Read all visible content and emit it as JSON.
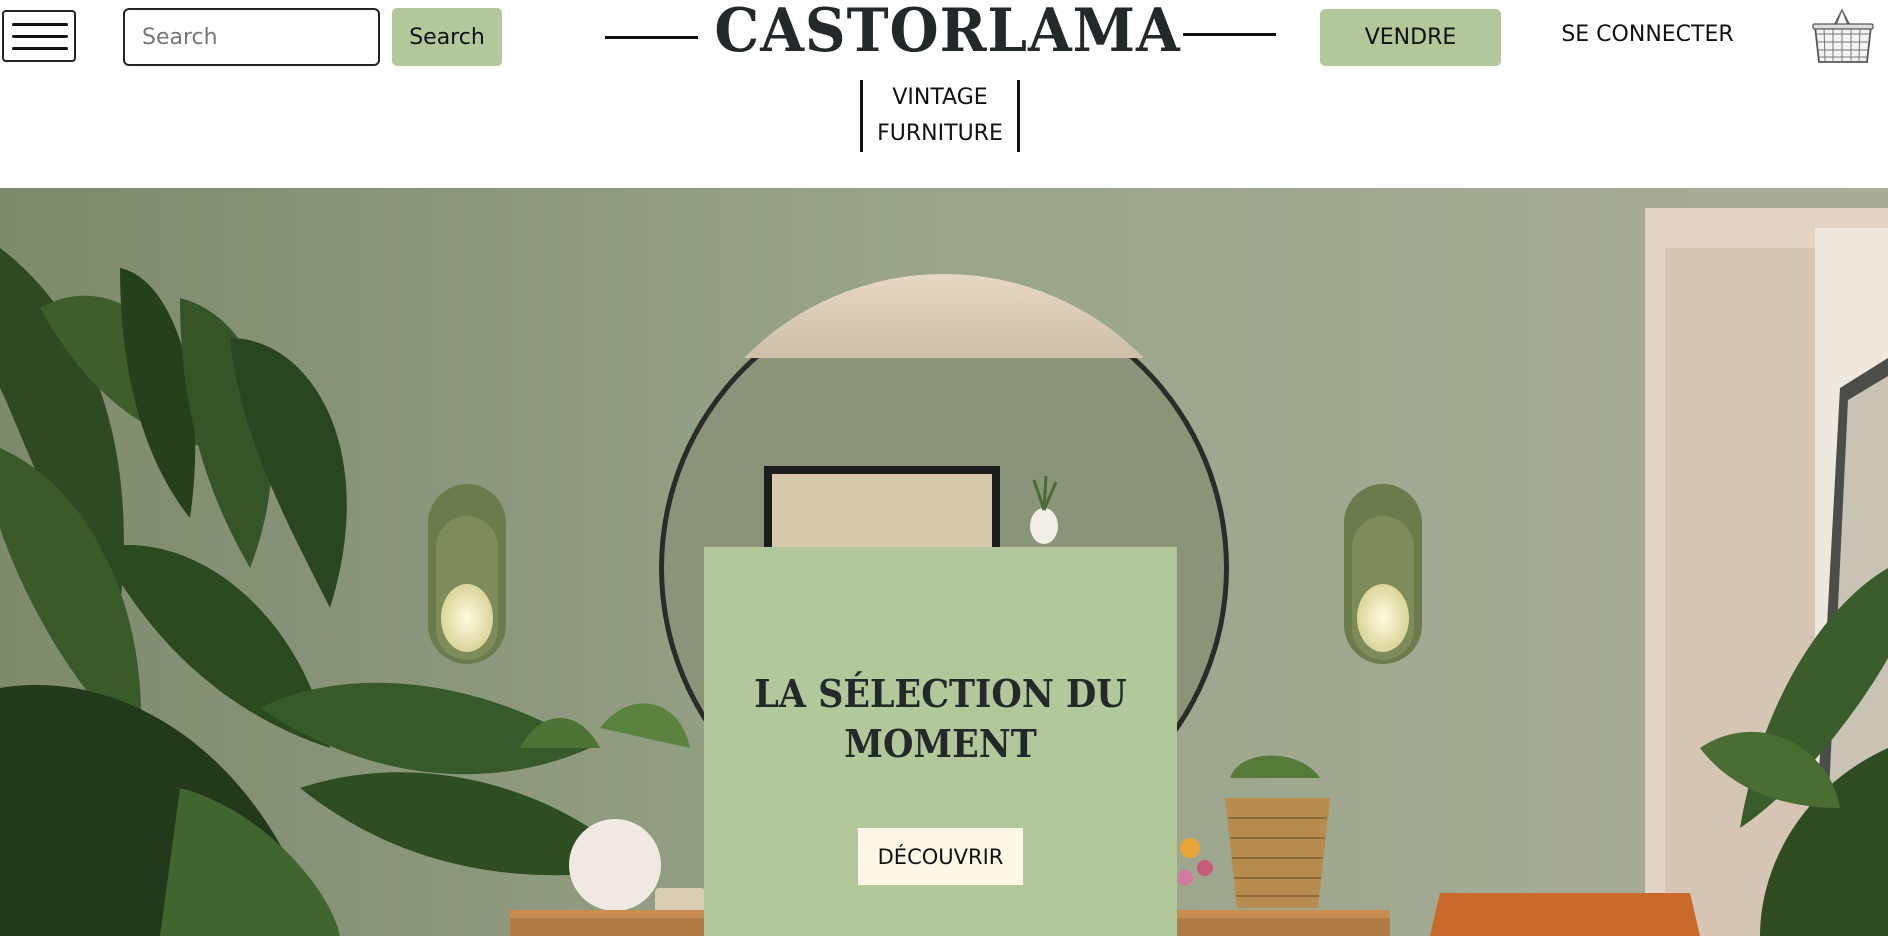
{
  "header": {
    "search_placeholder": "Search",
    "search_button": "Search",
    "logo": "CASTORLAMA",
    "tagline_line1": "VINTAGE",
    "tagline_line2": "FURNITURE",
    "sell_button": "VENDRE",
    "login_link": "SE CONNECTER"
  },
  "hero": {
    "title_line1": "LA SÉLECTION DU",
    "title_line2": "MOMENT",
    "cta": "DÉCOUVRIR"
  },
  "colors": {
    "accent": "#b2c89a",
    "cta_background": "#fdf8e6",
    "text_dark": "#23282b",
    "wall": "#8f9a80"
  },
  "icons": {
    "menu": "hamburger-menu-icon",
    "cart": "basket-icon"
  }
}
